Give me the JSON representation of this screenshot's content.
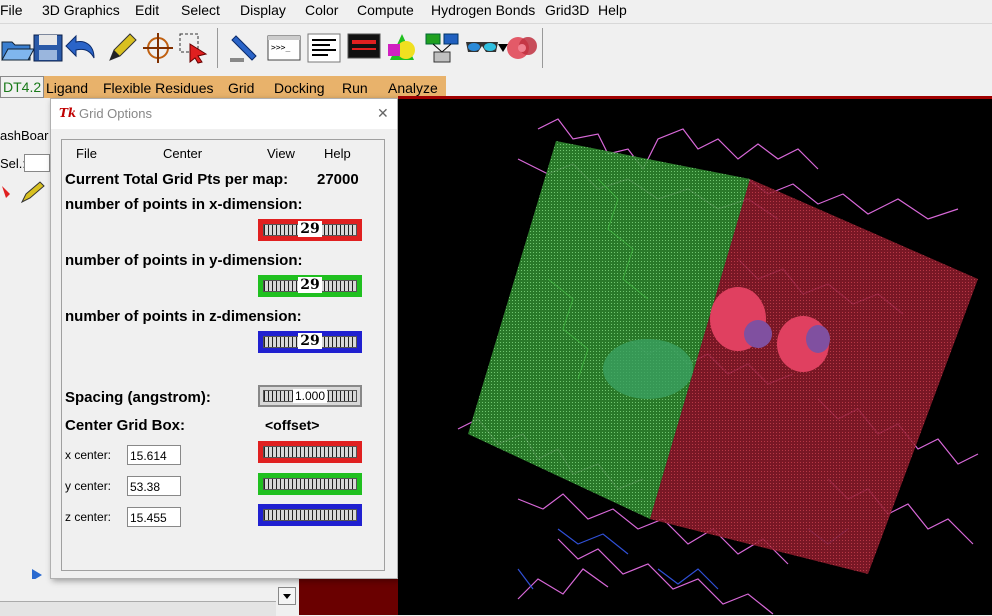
{
  "menubar": {
    "items": [
      "File",
      "3D Graphics",
      "Edit",
      "Select",
      "Display",
      "Color",
      "Compute",
      "Hydrogen Bonds",
      "Grid3D",
      "Help"
    ]
  },
  "tabs": {
    "items": [
      "DT4.2",
      "Ligand",
      "Flexible Residues",
      "Grid",
      "Docking",
      "Run",
      "Analyze"
    ]
  },
  "dashboard": {
    "title_fragment": "ashBoar",
    "sel_label": "Sel.:"
  },
  "dialog": {
    "title": "Grid Options",
    "tk_badge": "Tk",
    "close_glyph": "✕",
    "menu": [
      "File",
      "Center",
      "View",
      "Help"
    ],
    "total_label": "Current Total Grid Pts per map:",
    "total_value": "27000",
    "x_dim_label": "number of points in x-dimension:",
    "y_dim_label": "number of points in y-dimension:",
    "z_dim_label": "number of points in z-dimension:",
    "x_points": "29",
    "y_points": "29",
    "z_points": "29",
    "spacing_label": "Spacing (angstrom):",
    "spacing_value": "1.000",
    "center_label": "Center Grid Box:",
    "offset_label": "<offset>",
    "x_center_label": "x center:",
    "y_center_label": "y center:",
    "z_center_label": "z center:",
    "x_center": "15.614",
    "y_center": "53.38",
    "z_center": "15.455"
  },
  "colors": {
    "x_axis": "#e02020",
    "y_axis": "#20c020",
    "z_axis": "#2020d0",
    "viewer_bg": "#000000",
    "tab_bar": "#e8b26b"
  }
}
